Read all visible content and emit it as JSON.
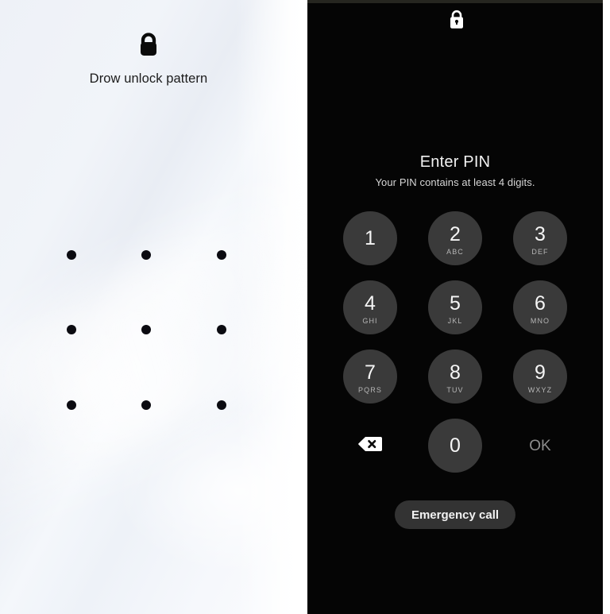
{
  "pattern_screen": {
    "lock_icon": "lock-icon",
    "title": "Drow unlock pattern",
    "grid": {
      "rows": 3,
      "cols": 3,
      "dot_color": "#0b0b11",
      "dots": [
        {
          "row": 1,
          "col": 1
        },
        {
          "row": 1,
          "col": 2
        },
        {
          "row": 1,
          "col": 3
        },
        {
          "row": 2,
          "col": 1
        },
        {
          "row": 2,
          "col": 2
        },
        {
          "row": 2,
          "col": 3
        },
        {
          "row": 3,
          "col": 1
        },
        {
          "row": 3,
          "col": 2
        },
        {
          "row": 3,
          "col": 3
        }
      ]
    },
    "background_color": "#eef1f7"
  },
  "pin_screen": {
    "lock_icon": "lock-icon",
    "heading": "Enter PIN",
    "subheading": "Your PIN contains at least 4 digits.",
    "background_color": "#050505",
    "key_background_color": "#3a3a3a",
    "keypad": [
      [
        {
          "digit": "1",
          "letters": "",
          "name": "key-1"
        },
        {
          "digit": "2",
          "letters": "ABC",
          "name": "key-2"
        },
        {
          "digit": "3",
          "letters": "DEF",
          "name": "key-3"
        }
      ],
      [
        {
          "digit": "4",
          "letters": "GHI",
          "name": "key-4"
        },
        {
          "digit": "5",
          "letters": "JKL",
          "name": "key-5"
        },
        {
          "digit": "6",
          "letters": "MNO",
          "name": "key-6"
        }
      ],
      [
        {
          "digit": "7",
          "letters": "PQRS",
          "name": "key-7"
        },
        {
          "digit": "8",
          "letters": "TUV",
          "name": "key-8"
        },
        {
          "digit": "9",
          "letters": "WXYZ",
          "name": "key-9"
        }
      ]
    ],
    "bottom_row": {
      "backspace_icon": "backspace-icon",
      "zero": {
        "digit": "0",
        "letters": ""
      },
      "ok_label": "OK"
    },
    "emergency_call_label": "Emergency call"
  }
}
